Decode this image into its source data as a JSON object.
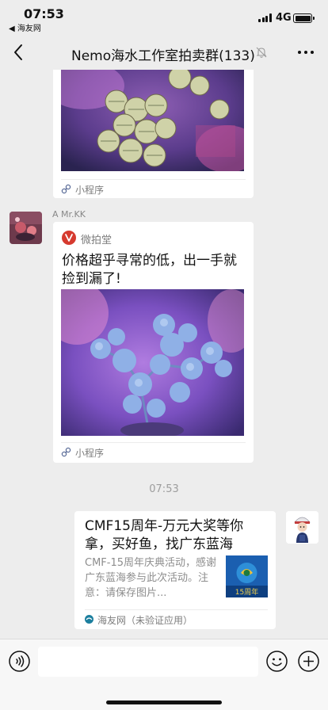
{
  "status_bar": {
    "time": "07:53",
    "back_app": "◀ 海友网",
    "network": "4G"
  },
  "nav": {
    "title": "Nemo海水工作室拍卖群(133)"
  },
  "messages": {
    "first_card": {
      "footer": "小程序"
    },
    "second": {
      "sender": "A  Mr.KK",
      "source": "微拍堂",
      "title": "价格超乎寻常的低，出一手就捡到漏了!",
      "footer": "小程序"
    },
    "timestamp": "07:53",
    "link_card": {
      "title": "CMF15周年-万元大奖等你拿，买好鱼，找广东蓝海",
      "description": "CMF-15周年庆典活动，感谢广东蓝海参与此次活动。注意：请保存图片...",
      "thumb_text": "15周年",
      "source": "海友网（未验证应用）"
    }
  },
  "colors": {
    "accent": "#d63a2f",
    "chat_bg": "#ededed",
    "card_bg": "#ffffff"
  },
  "icons": {
    "back": "chevron-left-icon",
    "mute": "bell-off-icon",
    "more": "more-dots-icon",
    "voice": "voice-icon",
    "emoji": "emoji-icon",
    "plus": "plus-icon",
    "link": "mini-program-link-icon"
  }
}
